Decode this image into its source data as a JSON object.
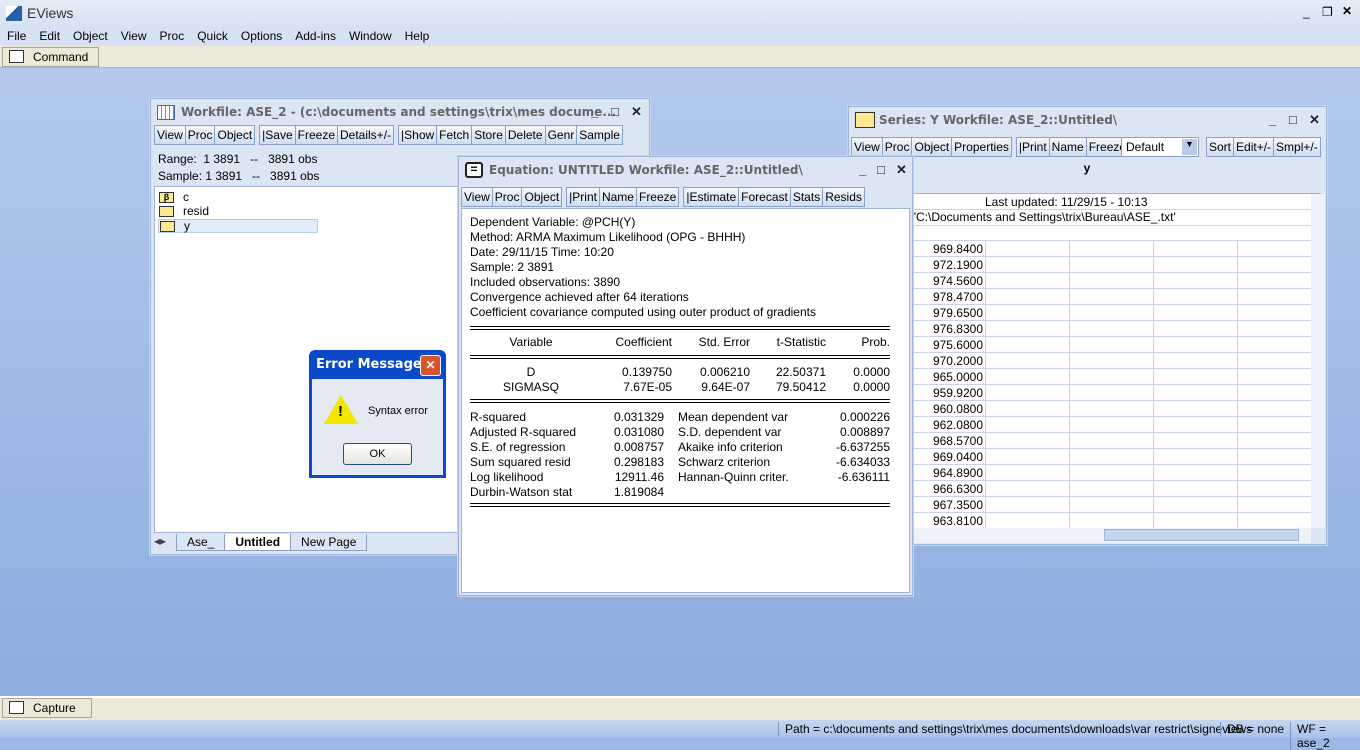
{
  "app": {
    "title": "EViews",
    "accent": "#d6e2f3"
  },
  "menu": [
    "File",
    "Edit",
    "Object",
    "View",
    "Proc",
    "Quick",
    "Options",
    "Add-ins",
    "Window",
    "Help"
  ],
  "command_label": "Command",
  "capture_label": "Capture",
  "status": {
    "path": "Path = c:\\documents and settings\\trix\\mes documents\\downloads\\var restrict\\signeviews",
    "db": "DB = none",
    "wf": "WF = ase_2"
  },
  "workfile": {
    "title": "Workfile: ASE_2 - (c:\\documents and settings\\trix\\mes docume...",
    "toolbar": [
      "View",
      "Proc",
      "Object",
      "|Save",
      "Freeze",
      "Details+/-",
      "|Show",
      "Fetch",
      "Store",
      "Delete",
      "Genr",
      "Sample"
    ],
    "range": "Range:  1 3891   --   3891 obs",
    "sample": "Sample: 1 3891   --   3891 obs",
    "objects": [
      {
        "name": "c",
        "icon": "coefficient-icon"
      },
      {
        "name": "resid",
        "icon": "series-icon"
      },
      {
        "name": "y",
        "icon": "series-icon",
        "selected": true
      }
    ],
    "tabs": [
      "Ase_",
      "Untitled",
      "New Page"
    ],
    "active_tab": "Untitled"
  },
  "equation": {
    "title": "Equation: UNTITLED   Workfile: ASE_2::Untitled\\",
    "toolbar": [
      "View",
      "Proc",
      "Object",
      "|Print",
      "Name",
      "Freeze",
      "|Estimate",
      "Forecast",
      "Stats",
      "Resids"
    ],
    "header": [
      "Dependent Variable: @PCH(Y)",
      "Method: ARMA Maximum Likelihood (OPG - BHHH)",
      "Date: 29/11/15   Time: 10:20",
      "Sample: 2 3891",
      "Included observations: 3890",
      "Convergence achieved after 64 iterations",
      "Coefficient covariance computed using outer product of gradients"
    ],
    "columns": [
      "Variable",
      "Coefficient",
      "Std. Error",
      "t-Statistic",
      "Prob."
    ],
    "rows": [
      [
        "D",
        "0.139750",
        "0.006210",
        "22.50371",
        "0.0000"
      ],
      [
        "SIGMASQ",
        "7.67E-05",
        "9.64E-07",
        "79.50412",
        "0.0000"
      ]
    ],
    "stats": [
      [
        "R-squared",
        "0.031329",
        "Mean dependent var",
        "0.000226"
      ],
      [
        "Adjusted R-squared",
        "0.031080",
        "S.D. dependent var",
        "0.008897"
      ],
      [
        "S.E. of regression",
        "0.008757",
        "Akaike info criterion",
        "-6.637255"
      ],
      [
        "Sum squared resid",
        "0.298183",
        "Schwarz criterion",
        "-6.634033"
      ],
      [
        "Log likelihood",
        "12911.46",
        "Hannan-Quinn criter.",
        "-6.636111"
      ],
      [
        "Durbin-Watson stat",
        "1.819084",
        "",
        ""
      ]
    ]
  },
  "series": {
    "title": "Series: Y   Workfile: ASE_2::Untitled\\",
    "toolbar": [
      "View",
      "Proc",
      "Object",
      "Properties",
      "|Print",
      "Name",
      "Freeze"
    ],
    "toolbar2": [
      "Sort",
      "Edit+/-",
      "Smpl+/-"
    ],
    "display_select": "Default",
    "column_header": "y",
    "last_updated": "Last updated: 11/29/15 - 10:13",
    "imported": "ported from 'C:\\Documents and Settings\\trix\\Bureau\\ASE_.txt'",
    "values": [
      "969.8400",
      "972.1900",
      "974.5600",
      "978.4700",
      "979.6500",
      "976.8300",
      "975.6000",
      "970.2000",
      "965.0000",
      "959.9200",
      "960.0800",
      "962.0800",
      "968.5700",
      "969.0400",
      "964.8900",
      "966.6300",
      "967.3500",
      "963.8100"
    ]
  },
  "error_dialog": {
    "title": "Error Message",
    "message": "Syntax error",
    "ok": "OK",
    "icon": "warning-icon"
  }
}
